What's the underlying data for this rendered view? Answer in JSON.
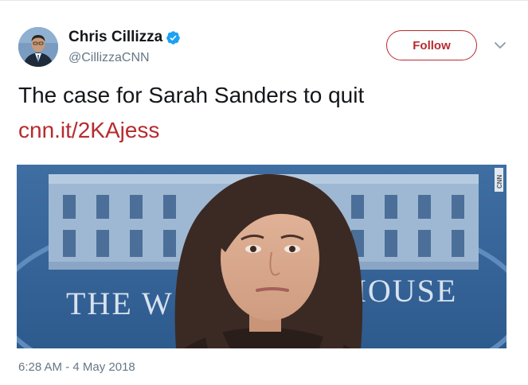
{
  "author": {
    "name": "Chris Cillizza",
    "handle": "@CillizzaCNN",
    "verified": true,
    "avatar_icon": "person-avatar"
  },
  "actions": {
    "follow_label": "Follow",
    "more_icon": "chevron-down-icon"
  },
  "tweet": {
    "text": "The case for Sarah Sanders to quit",
    "link": "cnn.it/2KAjess",
    "timestamp": "6:28 AM - 4 May 2018"
  },
  "media": {
    "image_type": "photo",
    "sign_left": "THE W",
    "sign_right": "HOUSE",
    "watermark": "CNN"
  },
  "colors": {
    "accent": "#b72b2e",
    "verified_blue": "#1da1f2",
    "secondary_text": "#657786",
    "primary_text": "#14171a"
  }
}
